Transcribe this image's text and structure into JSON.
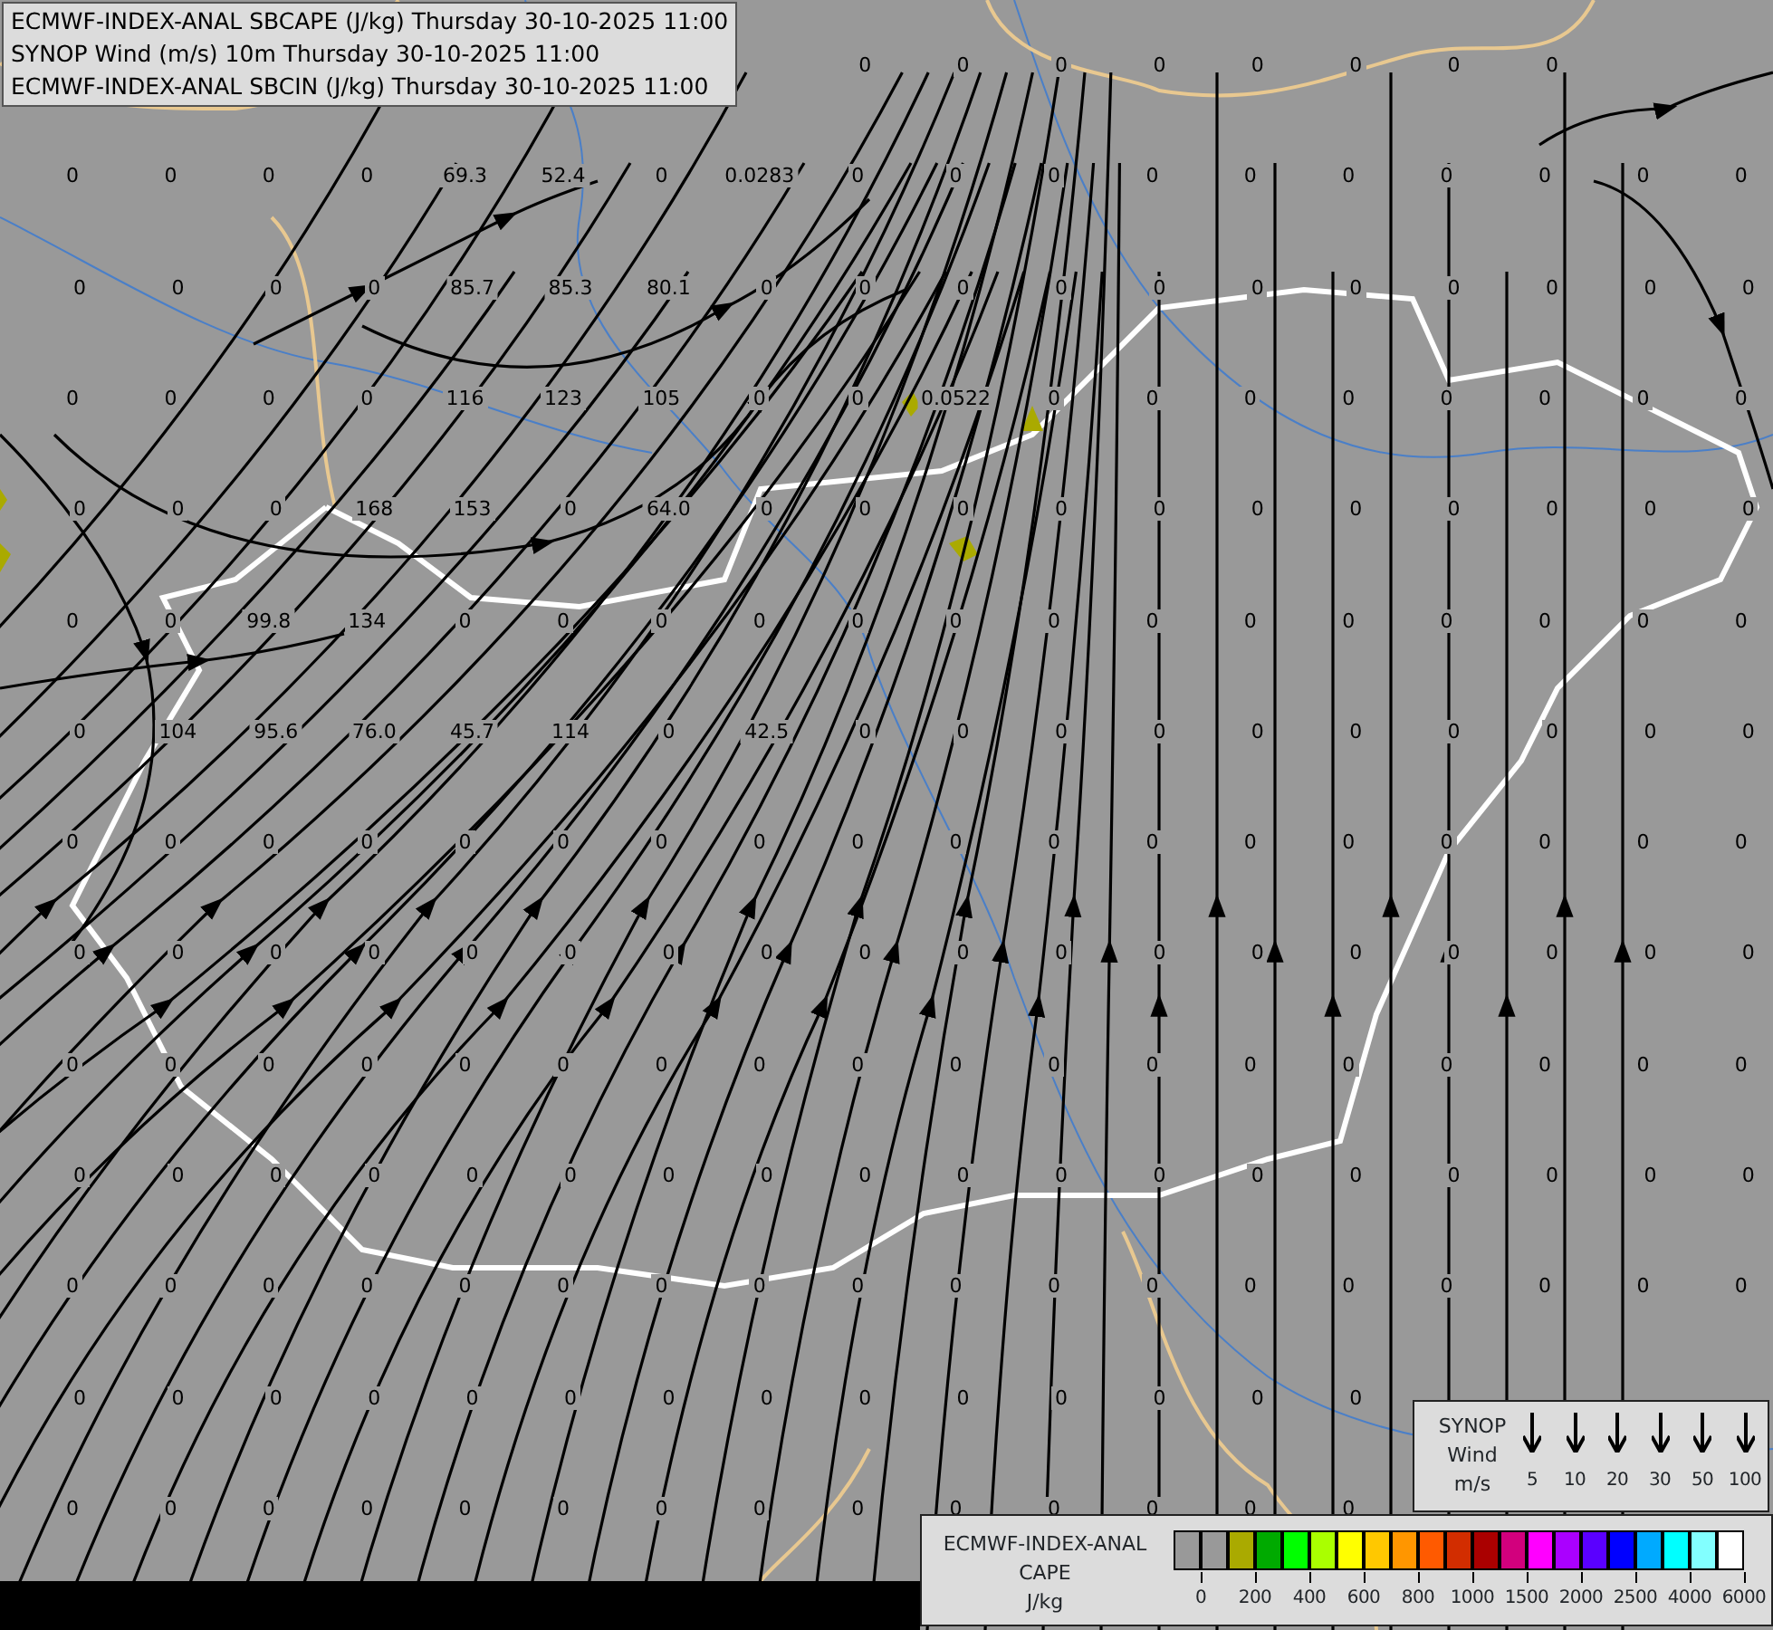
{
  "title_box": {
    "lines": [
      "ECMWF-INDEX-ANAL SBCAPE (J/kg) Thursday 30-10-2025 11:00",
      "SYNOP Wind (m/s) 10m Thursday 30-10-2025 11:00",
      "ECMWF-INDEX-ANAL SBCIN (J/kg) Thursday 30-10-2025 11:00"
    ]
  },
  "cape_values": {
    "rows": [
      [
        null,
        null,
        null,
        null,
        null,
        null,
        null,
        null,
        "0",
        "0",
        "0",
        "0",
        "0",
        "0",
        "0",
        "0",
        null,
        null
      ],
      [
        "0",
        "0",
        "0",
        "0",
        "69.3",
        "52.4",
        "0",
        "0.0283",
        "0",
        "0",
        "0",
        "0",
        "0",
        "0",
        "0",
        "0",
        "0",
        "0"
      ],
      [
        "0",
        "0",
        "0",
        "0",
        "85.7",
        "85.3",
        "80.1",
        "0",
        "0",
        "0",
        "0",
        "0",
        "0",
        "0",
        "0",
        "0",
        "0",
        "0"
      ],
      [
        "0",
        "0",
        "0",
        "0",
        "116",
        "123",
        "105",
        "0",
        "0",
        "0.0522",
        "0",
        "0",
        "0",
        "0",
        "0",
        "0",
        "0",
        "0"
      ],
      [
        "0",
        "0",
        "0",
        "168",
        "153",
        "0",
        "64.0",
        "0",
        "0",
        "0",
        "0",
        "0",
        "0",
        "0",
        "0",
        "0",
        "0",
        "0"
      ],
      [
        "0",
        "0",
        "99.8",
        "134",
        "0",
        "0",
        "0",
        "0",
        "0",
        "0",
        "0",
        "0",
        "0",
        "0",
        "0",
        "0",
        "0",
        "0"
      ],
      [
        "0",
        "104",
        "95.6",
        "76.0",
        "45.7",
        "114",
        "0",
        "42.5",
        "0",
        "0",
        "0",
        "0",
        "0",
        "0",
        "0",
        "0",
        "0",
        "0"
      ],
      [
        "0",
        "0",
        "0",
        "0",
        "0",
        "0",
        "0",
        "0",
        "0",
        "0",
        "0",
        "0",
        "0",
        "0",
        "0",
        "0",
        "0",
        "0"
      ],
      [
        "0",
        "0",
        "0",
        "0",
        "0",
        "0",
        "0",
        "0",
        "0",
        "0",
        "0",
        "0",
        "0",
        "0",
        "0",
        "0",
        "0",
        "0"
      ],
      [
        "0",
        "0",
        "0",
        "0",
        "0",
        "0",
        "0",
        "0",
        "0",
        "0",
        "0",
        "0",
        "0",
        "0",
        "0",
        "0",
        "0",
        "0"
      ],
      [
        "0",
        "0",
        "0",
        "0",
        "0",
        "0",
        "0",
        "0",
        "0",
        "0",
        "0",
        "0",
        "0",
        "0",
        "0",
        "0",
        "0",
        "0"
      ],
      [
        "0",
        "0",
        "0",
        "0",
        "0",
        "0",
        "0",
        "0",
        "0",
        "0",
        "0",
        "0",
        "0",
        "0",
        "0",
        "0",
        "0",
        "0"
      ],
      [
        "0",
        "0",
        "0",
        "0",
        "0",
        "0",
        "0",
        "0",
        "0",
        "0",
        "0",
        "0",
        "0",
        "0",
        null,
        null,
        null,
        null
      ],
      [
        "0",
        "0",
        "0",
        "0",
        "0",
        "0",
        "0",
        "0",
        "0",
        "0",
        "0",
        "0",
        "0",
        "0",
        null,
        null,
        null,
        null
      ]
    ]
  },
  "synop_legend": {
    "title_lines": [
      "SYNOP",
      "Wind",
      "m/s"
    ],
    "speeds": [
      "5",
      "10",
      "20",
      "30",
      "50",
      "100"
    ]
  },
  "cape_legend": {
    "title_lines": [
      "ECMWF-INDEX-ANAL",
      "CAPE",
      "J/kg"
    ],
    "bins": [
      {
        "color": "#999999"
      },
      {
        "color": "#999999"
      },
      {
        "color": "#aaaa00"
      },
      {
        "color": "#00aa00"
      },
      {
        "color": "#00ff00"
      },
      {
        "color": "#aaff00"
      },
      {
        "color": "#ffff00"
      },
      {
        "color": "#ffc800"
      },
      {
        "color": "#ff9600"
      },
      {
        "color": "#ff5a00"
      },
      {
        "color": "#d22d00"
      },
      {
        "color": "#aa0000"
      },
      {
        "color": "#d2007d"
      },
      {
        "color": "#ff00ff"
      },
      {
        "color": "#aa00ff"
      },
      {
        "color": "#5a00ff"
      },
      {
        "color": "#0000ff"
      },
      {
        "color": "#00aaff"
      },
      {
        "color": "#00ffff"
      },
      {
        "color": "#82ffff"
      },
      {
        "color": "#ffffff"
      }
    ],
    "tick_labels": [
      "0",
      "200",
      "400",
      "600",
      "800",
      "1000",
      "1500",
      "2000",
      "2500",
      "4000",
      "6000"
    ]
  }
}
